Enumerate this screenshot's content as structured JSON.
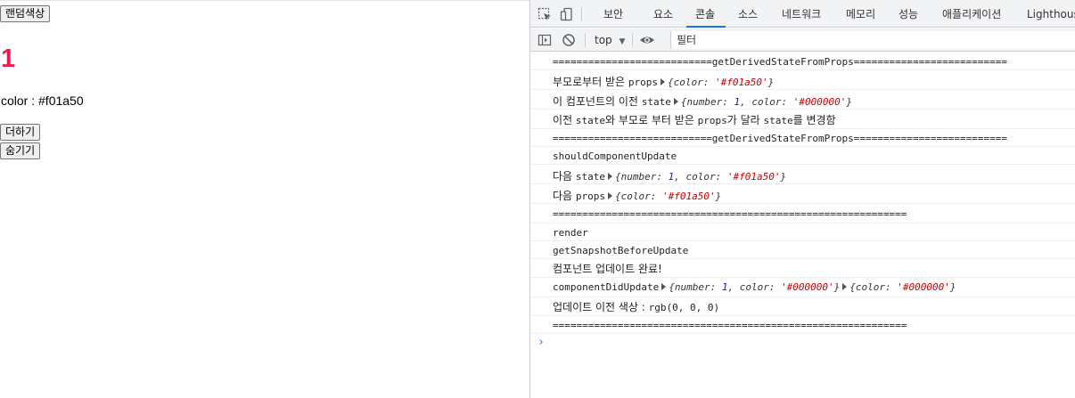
{
  "page": {
    "random_color_button": "랜덤색상",
    "number": "1",
    "color_line": "color : #f01a50",
    "number_color": "#f01a50",
    "add_button": "더하기",
    "hide_button": "숨기기"
  },
  "devtools": {
    "tabs": [
      "보안",
      "요소",
      "콘솔",
      "소스",
      "네트워크",
      "메모리",
      "성능",
      "애플리케이션",
      "Lighthouse"
    ],
    "active_tab": "콘솔",
    "accent": "#1a73e8",
    "context": "top",
    "filter_placeholder": "필터",
    "logs": {
      "l1": "===========================getDerivedStateFromProps==========================",
      "l2_text": "부모로부터 받은 ",
      "l2_word": "props",
      "l2_obj": {
        "prefix": "{color: ",
        "color": "'#f01a50'",
        "suffix": "}"
      },
      "l3_text": "이 컴포넌트의 이전 ",
      "l3_word": "state",
      "l3_obj": {
        "prefix": "{number: ",
        "number": "1",
        "mid": ", color: ",
        "color": "'#000000'",
        "suffix": "}"
      },
      "l4_a": "이전 ",
      "l4_b": "state",
      "l4_c": "와 부모로 부터 받은 ",
      "l4_d": "props",
      "l4_e": "가 달라 ",
      "l4_f": "state",
      "l4_g": "를 변경함",
      "l5": "===========================getDerivedStateFromProps==========================",
      "l6": "shouldComponentUpdate",
      "l7_text": "다음 ",
      "l7_word": "state",
      "l7_obj": {
        "prefix": "{number: ",
        "number": "1",
        "mid": ", color: ",
        "color": "'#f01a50'",
        "suffix": "}"
      },
      "l8_text": "다음 ",
      "l8_word": "props",
      "l8_obj": {
        "prefix": "{color: ",
        "color": "'#f01a50'",
        "suffix": "}"
      },
      "l9": "============================================================",
      "l10": "render",
      "l11": "getSnapshotBeforeUpdate",
      "l12": "컴포넌트 업데이트 완료!",
      "l13_word": "componentDidUpdate",
      "l13_obj1": {
        "prefix": "{number: ",
        "number": "1",
        "mid": ", color: ",
        "color": "'#000000'",
        "suffix": "}"
      },
      "l13_obj2": {
        "prefix": "{color: ",
        "color": "'#000000'",
        "suffix": "}"
      },
      "l14_text": "업데이트 이전 색상 : ",
      "l14_value": "rgb(0, 0, 0)",
      "l15": "============================================================"
    },
    "prompt": "›"
  }
}
